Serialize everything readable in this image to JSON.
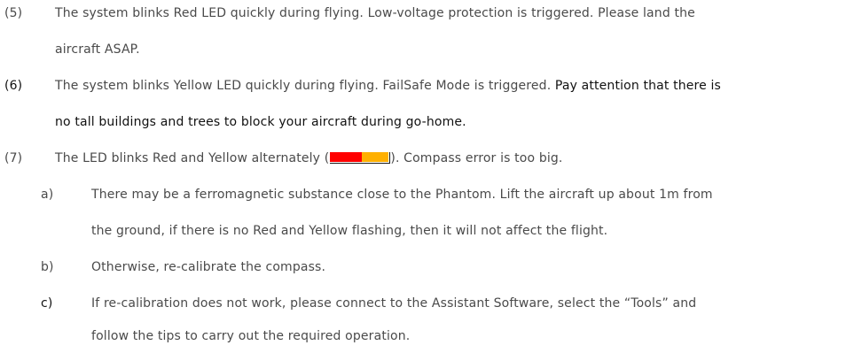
{
  "items": [
    {
      "marker": "(5)",
      "lines": [
        "The system blinks Red LED quickly during flying. Low-voltage protection is triggered. Please land the",
        "aircraft ASAP."
      ]
    },
    {
      "marker": "(6)",
      "lines": [
        "The system blinks Yellow LED quickly during flying. FailSafe Mode is triggered.",
        "Pay attention that there is",
        "no tall buildings and trees to block your aircraft during go-home."
      ]
    },
    {
      "marker": "(7)",
      "line_before_led": "The LED blinks Red and Yellow alternately (",
      "line_after_led": "). Compass error is too big.",
      "led_colors": [
        "#ff0000",
        "#ffb000"
      ],
      "subitems": [
        {
          "marker": "a)",
          "lines": [
            "There may be a ferromagnetic substance close to the Phantom. Lift the aircraft up about 1m from",
            "the ground, if there is no Red and Yellow flashing, then it will not affect the flight."
          ]
        },
        {
          "marker": "b)",
          "lines": [
            "Otherwise, re-calibrate the compass."
          ]
        },
        {
          "marker": "c)",
          "lines": [
            "If re-calibration does not work, please connect to the Assistant Software, select the “Tools” and",
            "follow the tips to carry out the required operation."
          ]
        }
      ]
    }
  ]
}
